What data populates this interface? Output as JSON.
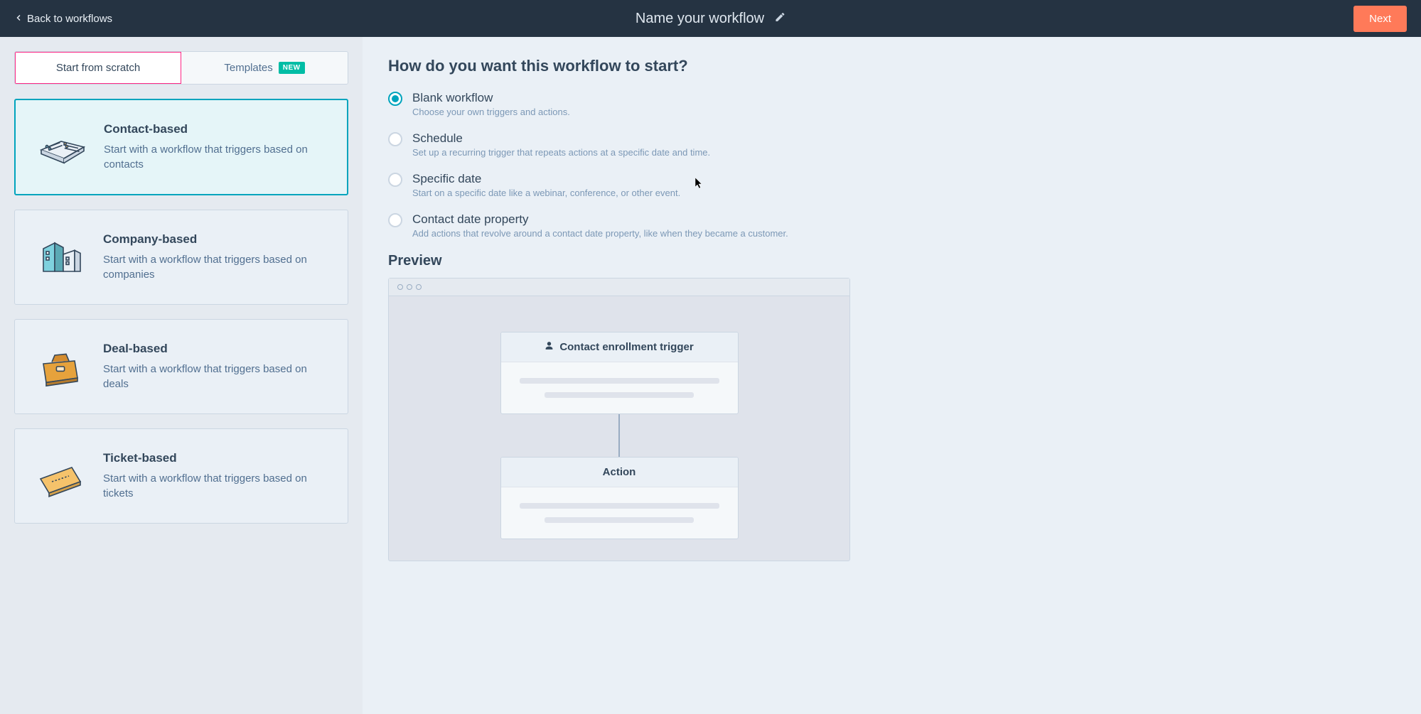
{
  "topbar": {
    "back_label": "Back to workflows",
    "title": "Name your workflow",
    "next_label": "Next"
  },
  "tabs": {
    "scratch": "Start from scratch",
    "templates": "Templates",
    "new_badge": "NEW"
  },
  "workflow_types": [
    {
      "title": "Contact-based",
      "desc": "Start with a workflow that triggers based on contacts"
    },
    {
      "title": "Company-based",
      "desc": "Start with a workflow that triggers based on companies"
    },
    {
      "title": "Deal-based",
      "desc": "Start with a workflow that triggers based on deals"
    },
    {
      "title": "Ticket-based",
      "desc": "Start with a workflow that triggers based on tickets"
    }
  ],
  "start_question": "How do you want this workflow to start?",
  "start_options": [
    {
      "label": "Blank workflow",
      "desc": "Choose your own triggers and actions."
    },
    {
      "label": "Schedule",
      "desc": "Set up a recurring trigger that repeats actions at a specific date and time."
    },
    {
      "label": "Specific date",
      "desc": "Start on a specific date like a webinar, conference, or other event."
    },
    {
      "label": "Contact date property",
      "desc": "Add actions that revolve around a contact date property, like when they became a customer."
    }
  ],
  "preview": {
    "heading": "Preview",
    "trigger_label": "Contact enrollment trigger",
    "action_label": "Action"
  }
}
